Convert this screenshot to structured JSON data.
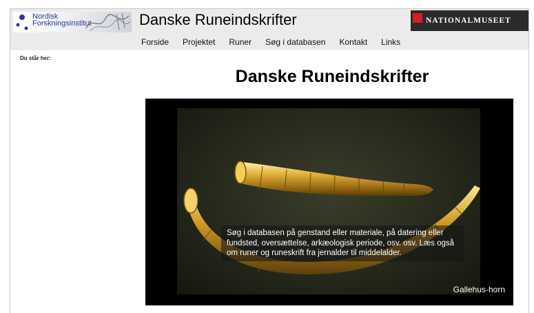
{
  "header": {
    "nfi_logo_line1": "Nordisk",
    "nfi_logo_line2": "Forskningsinstitut",
    "site_title": "Danske Runeindskrifter",
    "museum_logo": "NATIONALMUSEET"
  },
  "nav": {
    "items": [
      {
        "label": "Forside"
      },
      {
        "label": "Projektet"
      },
      {
        "label": "Runer"
      },
      {
        "label": "Søg i databasen"
      },
      {
        "label": "Kontakt"
      },
      {
        "label": "Links"
      }
    ]
  },
  "breadcrumb": "Du står her:",
  "main": {
    "page_title": "Danske Runeindskrifter",
    "hero_caption": "Søg i databasen på genstand eller materiale, på datering eller fundsted, oversættelse, arkæologisk periode, osv. osv. Læs også om runer og runeskrift fra jernalder til middelalder.",
    "hero_credit": "Gallehus-horn"
  },
  "colors": {
    "header_bg": "#ebebeb",
    "museum_logo_bg": "#2b2b2b",
    "museum_logo_accent": "#d21f1f",
    "nfi_text": "#2a3c8c",
    "gold": "#d7a52c"
  }
}
